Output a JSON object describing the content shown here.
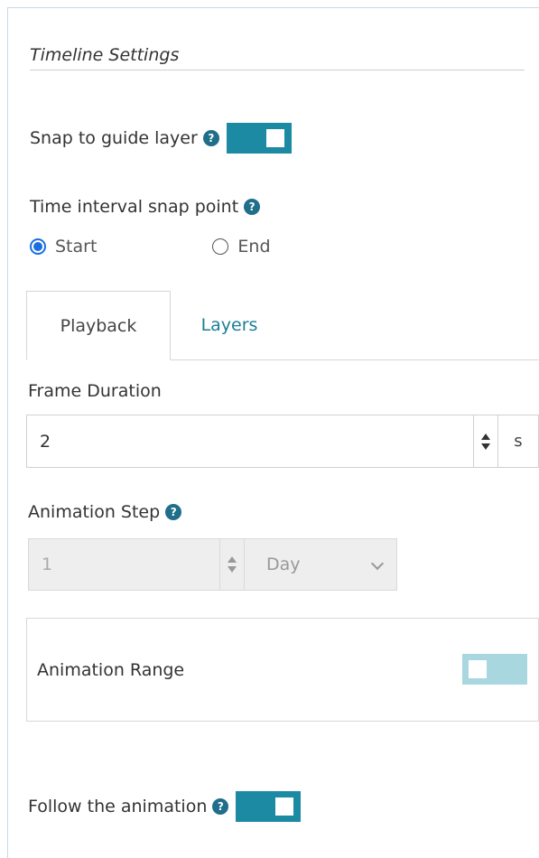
{
  "section_title": "Timeline Settings",
  "snap_to_guide": {
    "label": "Snap to guide layer",
    "enabled": true
  },
  "snap_point": {
    "label": "Time interval snap point",
    "options": [
      {
        "label": "Start",
        "selected": true
      },
      {
        "label": "End",
        "selected": false
      }
    ]
  },
  "tabs": [
    {
      "label": "Playback",
      "active": true
    },
    {
      "label": "Layers",
      "active": false
    }
  ],
  "frame_duration": {
    "label": "Frame Duration",
    "value": "2",
    "unit": "s"
  },
  "animation_step": {
    "label": "Animation Step",
    "value": "1",
    "unit": "Day",
    "disabled": true
  },
  "animation_range": {
    "label": "Animation Range",
    "enabled": false
  },
  "follow_animation": {
    "label": "Follow the animation",
    "enabled": true
  },
  "colors": {
    "accent": "#1c8aa3",
    "accent_light": "#a9d7e0",
    "help_icon": "#1f6e8a",
    "radio_selected": "#1a6fe0",
    "tab_link": "#1a7f96"
  },
  "icons": {
    "help": "question-circle-icon",
    "stepper_up": "caret-up-icon",
    "stepper_down": "caret-down-icon",
    "dropdown": "chevron-down-icon"
  },
  "help_glyph": "?"
}
